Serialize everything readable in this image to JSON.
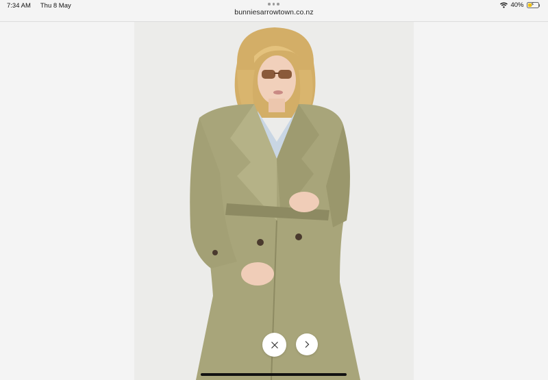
{
  "status_bar": {
    "time": "7:34 AM",
    "date": "Thu 8 May",
    "battery_percent": "40%",
    "battery_level": 0.4,
    "wifi_icon": "wifi-icon",
    "more_icon": "more-dots-icon"
  },
  "browser": {
    "address": "bunniesarrowtown.co.nz"
  },
  "viewer": {
    "image_subject": "product-photo",
    "close_icon": "close-icon",
    "next_icon": "chevron-right-icon"
  },
  "colors": {
    "coat": "#a8a57a",
    "coat_shadow": "#8d8a62",
    "shirt": "#c9d6e4",
    "hair": "#d9b56e",
    "background": "#ececea"
  }
}
